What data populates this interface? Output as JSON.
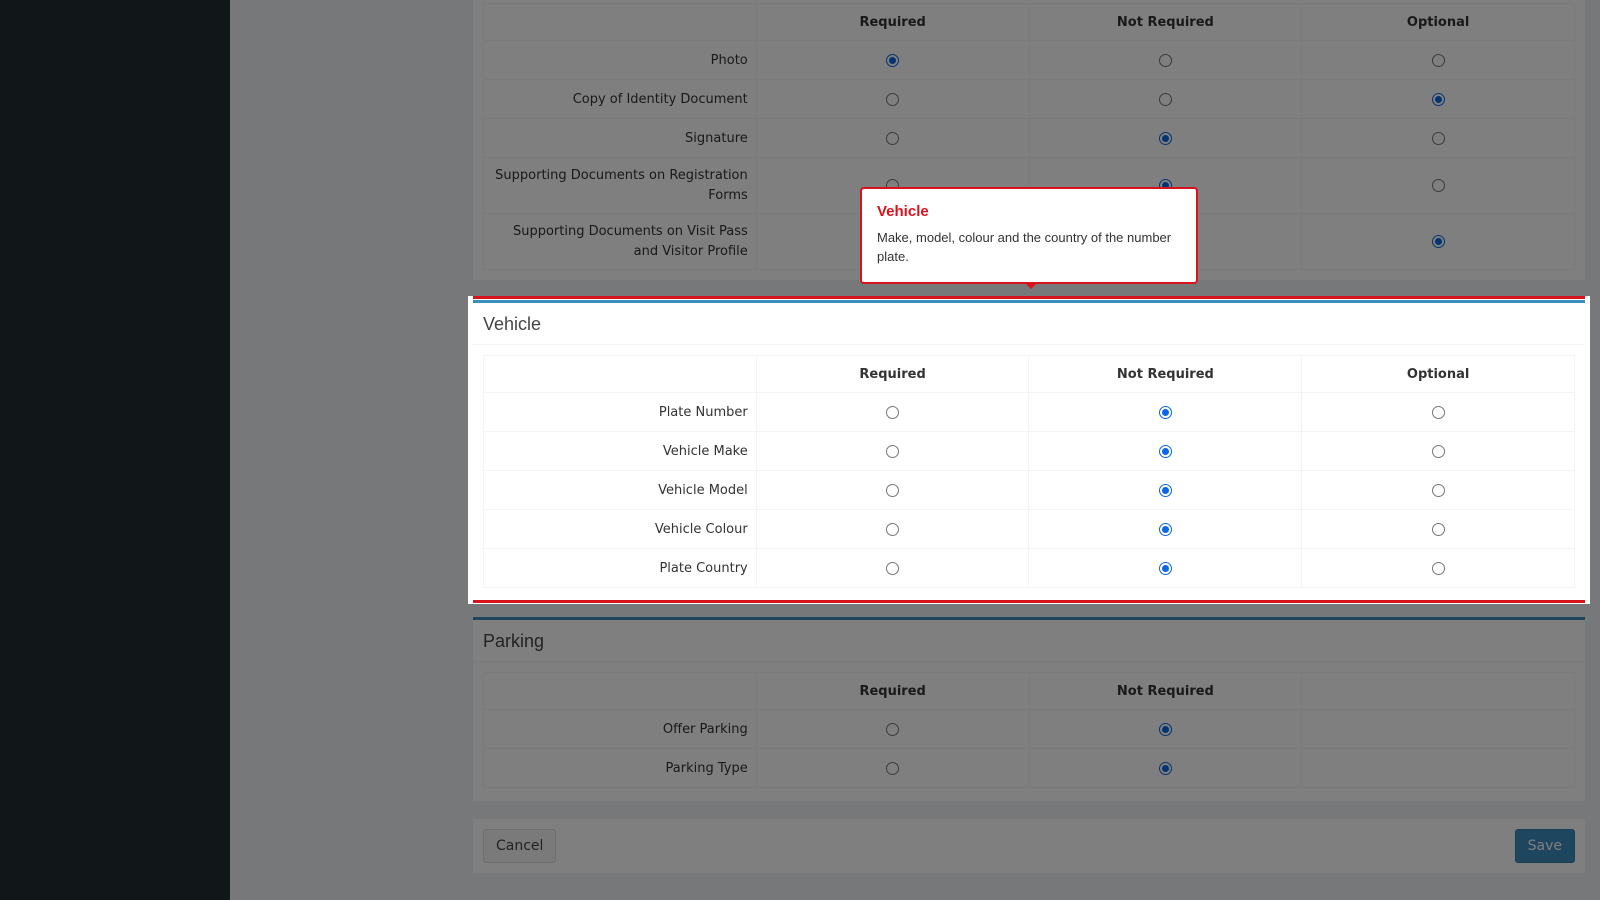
{
  "colors": {
    "accent": "#3c8dbc",
    "highlight": "#d9131d",
    "radio": "#0a66e4",
    "sidebar": "#222d32"
  },
  "columns": [
    "Required",
    "Not Required",
    "Optional"
  ],
  "documents": {
    "rows": [
      {
        "label": "Photo",
        "selected": 0
      },
      {
        "label": "Copy of Identity Document",
        "selected": 2
      },
      {
        "label": "Signature",
        "selected": 1
      },
      {
        "label": "Supporting Documents on Registration Forms",
        "selected": 1
      },
      {
        "label": "Supporting Documents on Visit Pass and Visitor Profile",
        "selected": 2
      }
    ]
  },
  "vehicle": {
    "title": "Vehicle",
    "rows": [
      {
        "label": "Plate Number",
        "selected": 1
      },
      {
        "label": "Vehicle Make",
        "selected": 1
      },
      {
        "label": "Vehicle Model",
        "selected": 1
      },
      {
        "label": "Vehicle Colour",
        "selected": 1
      },
      {
        "label": "Plate Country",
        "selected": 1
      }
    ]
  },
  "parking": {
    "title": "Parking",
    "columns": [
      "Required",
      "Not Required"
    ],
    "rows": [
      {
        "label": "Offer Parking",
        "selected": 1
      },
      {
        "label": "Parking Type",
        "selected": 1
      }
    ]
  },
  "tooltip": {
    "title": "Vehicle",
    "text": "Make, model, colour and the country of the number plate."
  },
  "footer": {
    "cancel_label": "Cancel",
    "save_label": "Save"
  }
}
